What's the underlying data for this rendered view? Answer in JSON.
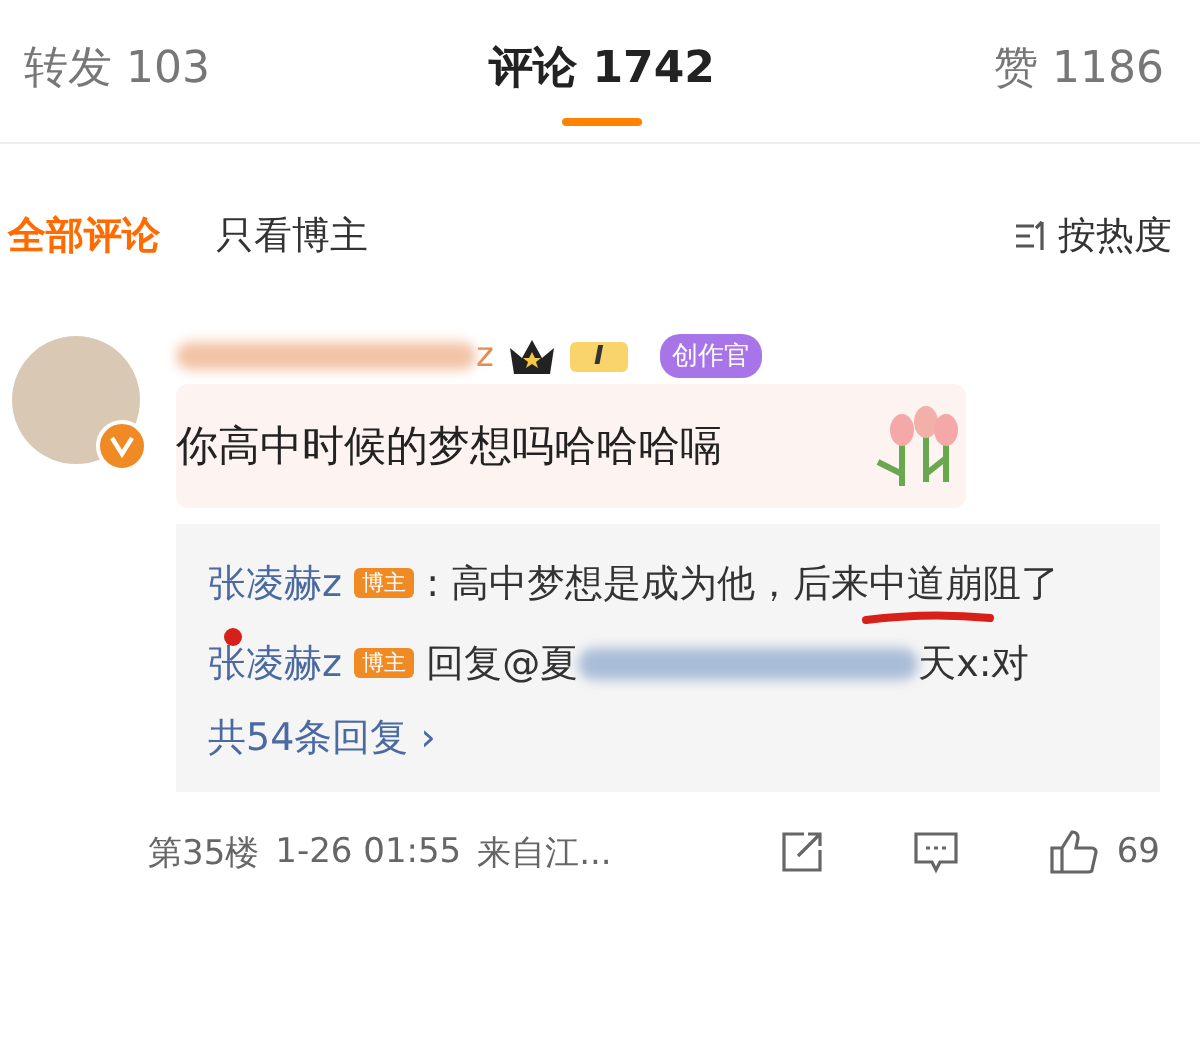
{
  "tabs": [
    {
      "label": "转发",
      "count": "103",
      "selected": false
    },
    {
      "label": "评论",
      "count": "1742",
      "selected": true
    },
    {
      "label": "赞",
      "count": "1186",
      "selected": false
    }
  ],
  "filters": [
    {
      "label": "全部评论",
      "selected": true
    },
    {
      "label": "只看博主",
      "selected": false
    }
  ],
  "sort": {
    "label": "按热度"
  },
  "comment": {
    "user_suffix": "z",
    "level_badge": "I",
    "creator_badge": "创作官",
    "verified": true,
    "text": "你高中时候的梦想吗哈哈哈嗝",
    "replies": [
      {
        "user": "张凌赫z",
        "badge": "博主",
        "text": ": 高中梦想是成为他，后来中道崩阻了"
      },
      {
        "user": "张凌赫z",
        "badge": "博主",
        "text_before": "回复@夏",
        "text_after": "天x:对"
      }
    ],
    "more_replies": "共54条回复 ›",
    "floor": "第35楼",
    "time": "1-26 01:55",
    "location": "来自江...",
    "likes": "69"
  }
}
